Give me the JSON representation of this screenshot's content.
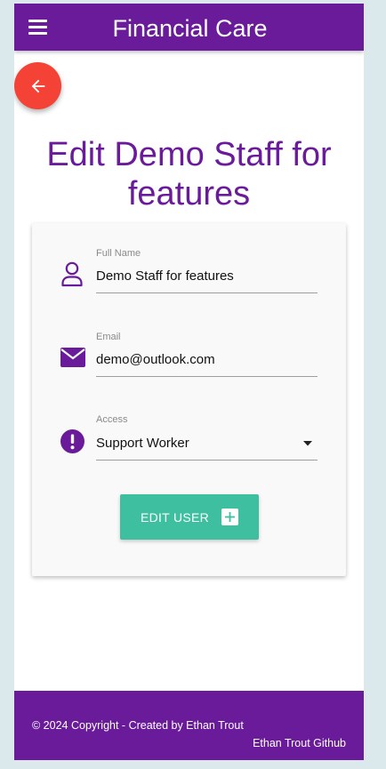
{
  "navbar": {
    "title": "Financial Care",
    "menu_icon": "hamburger-menu-icon"
  },
  "back_button": {
    "icon": "arrow-left-icon",
    "color": "#f44336"
  },
  "page": {
    "title": "Edit Demo Staff for features"
  },
  "form": {
    "full_name": {
      "label": "Full Name",
      "value": "Demo Staff for features",
      "icon": "person-icon"
    },
    "email": {
      "label": "Email",
      "value": "demo@outlook.com",
      "icon": "envelope-icon"
    },
    "access": {
      "label": "Access",
      "value": "Support Worker",
      "icon": "exclamation-circle-icon"
    },
    "submit": {
      "label": "EDIT USER",
      "icon": "plus-box-icon"
    }
  },
  "footer": {
    "copyright": "© 2024 Copyright - Created by Ethan Trout",
    "github_link": "Ethan Trout Github"
  },
  "colors": {
    "primary": "#6a1b9a",
    "accent": "#3dbfa0",
    "danger": "#f44336",
    "background": "#dce9ec"
  }
}
